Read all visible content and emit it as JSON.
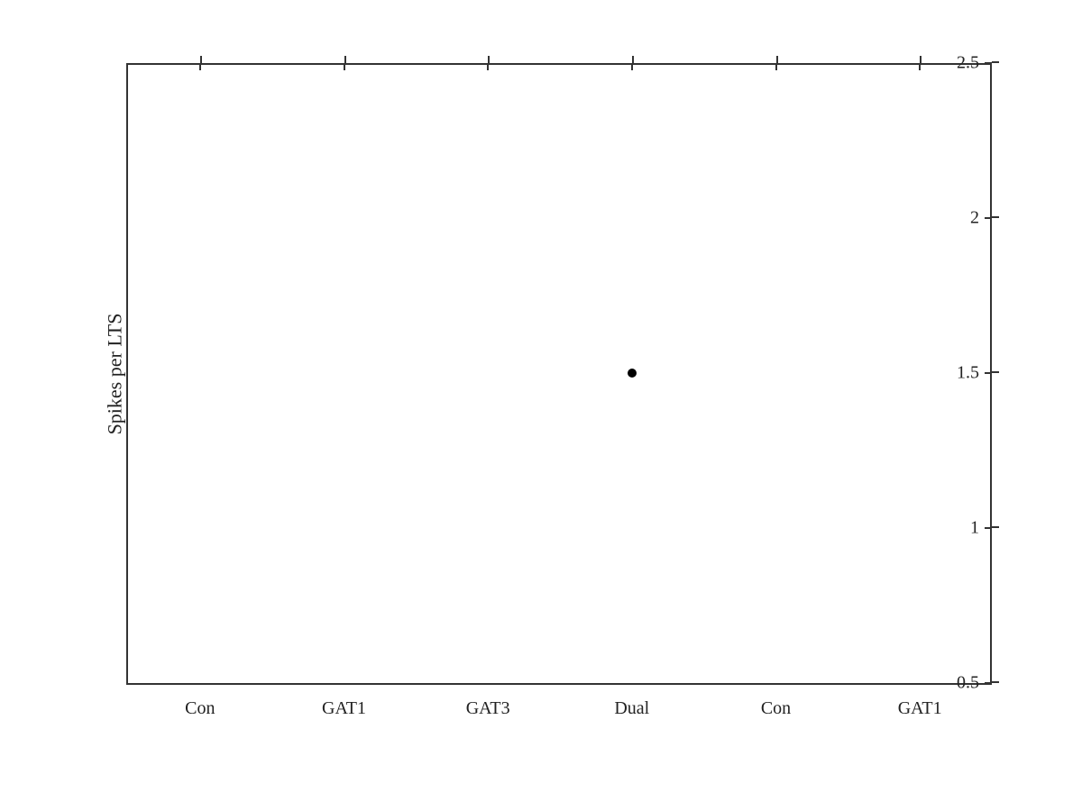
{
  "chart": {
    "title": "",
    "y_axis": {
      "label": "Spikes per LTS",
      "min": 0.5,
      "max": 2.5,
      "ticks": [
        {
          "value": 0.5,
          "label": "0.5",
          "pct": 0
        },
        {
          "value": 1.0,
          "label": "1",
          "pct": 25
        },
        {
          "value": 1.5,
          "label": "1.5",
          "pct": 50
        },
        {
          "value": 2.0,
          "label": "2",
          "pct": 75
        },
        {
          "value": 2.5,
          "label": "2.5",
          "pct": 100
        }
      ]
    },
    "x_axis": {
      "categories": [
        {
          "label": "Con",
          "pct": 8.33
        },
        {
          "label": "GAT1",
          "pct": 25
        },
        {
          "label": "GAT3",
          "pct": 41.67
        },
        {
          "label": "Dual",
          "pct": 58.33
        },
        {
          "label": "Con",
          "pct": 75
        },
        {
          "label": "GAT1",
          "pct": 91.67
        }
      ]
    },
    "data_points": [
      {
        "x_pct": 58.33,
        "y_pct": 50,
        "label": "Dual 1.5"
      }
    ]
  }
}
